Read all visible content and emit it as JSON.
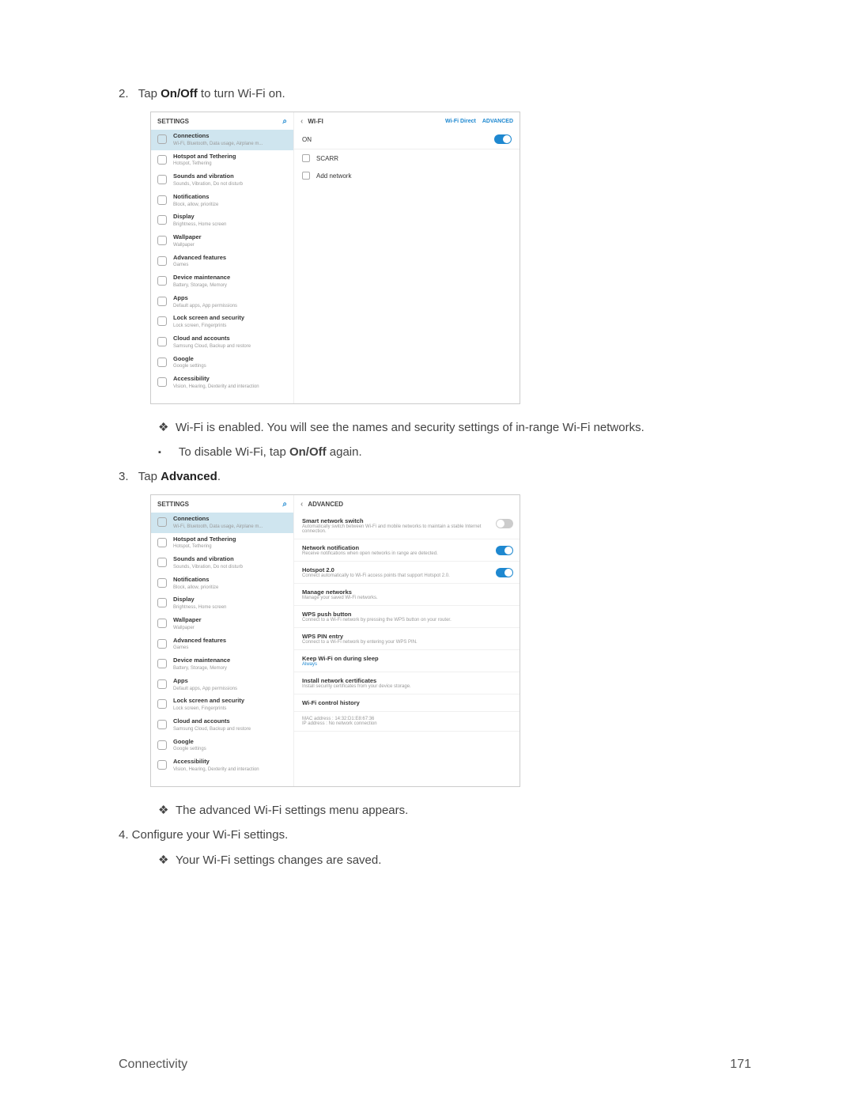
{
  "steps": {
    "s2_prefix": "2.",
    "s2_a": "Tap ",
    "s2_b": "On/Off",
    "s2_c": " to turn Wi-Fi on.",
    "s3_prefix": "3.",
    "s3_a": "Tap ",
    "s3_b": "Advanced",
    "s3_c": ".",
    "s4": "4.   Configure your Wi-Fi settings."
  },
  "bullets": {
    "b1": "Wi-Fi is enabled. You will see the names and security settings of in-range Wi-Fi networks.",
    "b2_a": "To disable Wi-Fi, tap ",
    "b2_b": "On/Off",
    "b2_c": " again.",
    "b3": "The advanced Wi-Fi settings menu appears.",
    "b4": "Your Wi-Fi settings changes are saved."
  },
  "settings_hdr": "SETTINGS",
  "wifi_hdr": "WI-FI",
  "wifi_direct": "Wi-Fi Direct",
  "advanced_link": "ADVANCED",
  "advanced_hdr": "ADVANCED",
  "on_label": "ON",
  "sidebar": [
    {
      "title": "Connections",
      "sub": "Wi-Fi, Bluetooth, Data usage, Airplane m..."
    },
    {
      "title": "Hotspot and Tethering",
      "sub": "Hotspot, Tethering"
    },
    {
      "title": "Sounds and vibration",
      "sub": "Sounds, Vibration, Do not disturb"
    },
    {
      "title": "Notifications",
      "sub": "Block, allow, prioritize"
    },
    {
      "title": "Display",
      "sub": "Brightness, Home screen"
    },
    {
      "title": "Wallpaper",
      "sub": "Wallpaper"
    },
    {
      "title": "Advanced features",
      "sub": "Games"
    },
    {
      "title": "Device maintenance",
      "sub": "Battery, Storage, Memory"
    },
    {
      "title": "Apps",
      "sub": "Default apps, App permissions"
    },
    {
      "title": "Lock screen and security",
      "sub": "Lock screen, Fingerprints"
    },
    {
      "title": "Cloud and accounts",
      "sub": "Samsung Cloud, Backup and restore"
    },
    {
      "title": "Google",
      "sub": "Google settings"
    },
    {
      "title": "Accessibility",
      "sub": "Vision, Hearing, Dexterity and interaction"
    }
  ],
  "networks": [
    {
      "name": "SCARR"
    },
    {
      "name": "Add network"
    }
  ],
  "adv": [
    {
      "t": "Smart network switch",
      "s": "Automatically switch between Wi-Fi and mobile networks to maintain a stable Internet connection.",
      "tg": "off"
    },
    {
      "t": "Network notification",
      "s": "Receive notifications when open networks in range are detected.",
      "tg": "on"
    },
    {
      "t": "Hotspot 2.0",
      "s": "Connect automatically to Wi-Fi access points that support Hotspot 2.0.",
      "tg": "on"
    },
    {
      "t": "Manage networks",
      "s": "Manage your saved Wi-Fi networks."
    },
    {
      "t": "WPS push button",
      "s": "Connect to a Wi-Fi network by pressing the WPS button on your router."
    },
    {
      "t": "WPS PIN entry",
      "s": "Connect to a Wi-Fi network by entering your WPS PIN."
    },
    {
      "t": "Keep Wi-Fi on during sleep",
      "s": "Always",
      "blue": true
    },
    {
      "t": "Install network certificates",
      "s": "Install security certificates from your device storage."
    },
    {
      "t": "Wi-Fi control history",
      "s": ""
    },
    {
      "t": "",
      "s": "MAC address : 14:32:D1:E8:67:36\nIP address : No network connection"
    }
  ],
  "footer": {
    "section": "Connectivity",
    "page": "171"
  }
}
